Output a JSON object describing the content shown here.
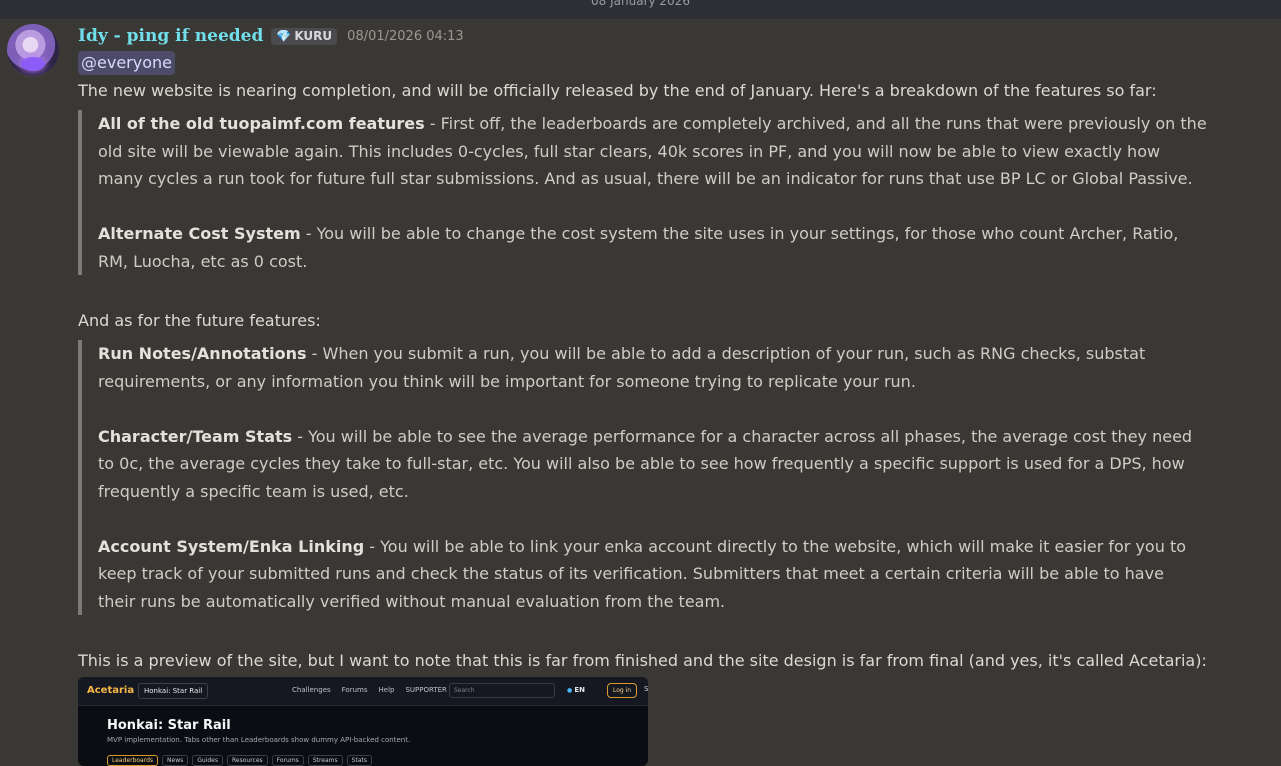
{
  "date_divider": "08 January 2026",
  "message": {
    "username": "Idy - ping if needed",
    "tag": "KURU",
    "gem_icon": "gem-icon",
    "timestamp": "08/01/2026 04:13",
    "mention": "@everyone",
    "intro": "The new website is nearing completion, and will be officially released by the end of January. Here's a breakdown of the features so far:",
    "current_features": [
      {
        "title": "All of the old tuopaimf.com features",
        "lines": [
          " - First off, the leaderboards are completely archived, and all the runs that were previously on the",
          "old site will be viewable again. This includes 0-cycles, full star clears, 40k scores in PF, and you will now be able to view exactly how",
          "many cycles a run took for future full star submissions. And as usual, there will be an indicator for runs that use BP LC or Global Passive."
        ]
      },
      {
        "title": "Alternate Cost System",
        "lines": [
          " - You will be able to change the cost system the site uses in your settings, for those who count Archer, Ratio,",
          "RM, Luocha, etc as 0 cost."
        ]
      }
    ],
    "future_intro": "And as for the future features:",
    "future_features": [
      {
        "title": "Run Notes/Annotations",
        "lines": [
          " - When you submit a run, you will be able to add a description of your run, such as RNG checks, substat",
          "requirements, or any information you think will be important for someone trying to replicate your run."
        ]
      },
      {
        "title": "Character/Team Stats",
        "lines": [
          " - You will be able to see the average performance for a character across all phases, the average cost they need",
          "to 0c, the average cycles they take to full-star, etc. You will also be able to see how frequently a specific support is used for a DPS, how",
          "frequently a specific team is used, etc."
        ]
      },
      {
        "title": "Account System/Enka Linking",
        "lines": [
          " - You will be able to link your enka account directly to the website, which will make it easier for you to",
          "keep track of your submitted runs and check the status of its verification. Submitters that meet a certain criteria will be able to have",
          "their runs be automatically verified without manual evaluation from the team."
        ]
      }
    ],
    "preview_caption": "This is a preview of the site, but I want to note that this is far from finished and the site design is far from final (and yes, it's called Acetaria):"
  },
  "preview": {
    "brand": "Acetaria",
    "game_selector": "Honkai: Star Rail",
    "nav": [
      "Challenges",
      "Forums",
      "Help",
      "SUPPORTER"
    ],
    "search_placeholder": "Search",
    "language": "EN",
    "login": "Log in",
    "overflow": "S",
    "title": "Honkai: Star Rail",
    "subtitle": "MVP implementation. Tabs other than Leaderboards show dummy API-backed content.",
    "tabs": [
      "Leaderboards",
      "News",
      "Guides",
      "Resources",
      "Forums",
      "Streams",
      "Stats"
    ]
  },
  "colors": {
    "background": "#3a3834",
    "username": "#71dfeb",
    "quote_bar": "#7d7a75",
    "preview_accent": "#f7b84a"
  }
}
